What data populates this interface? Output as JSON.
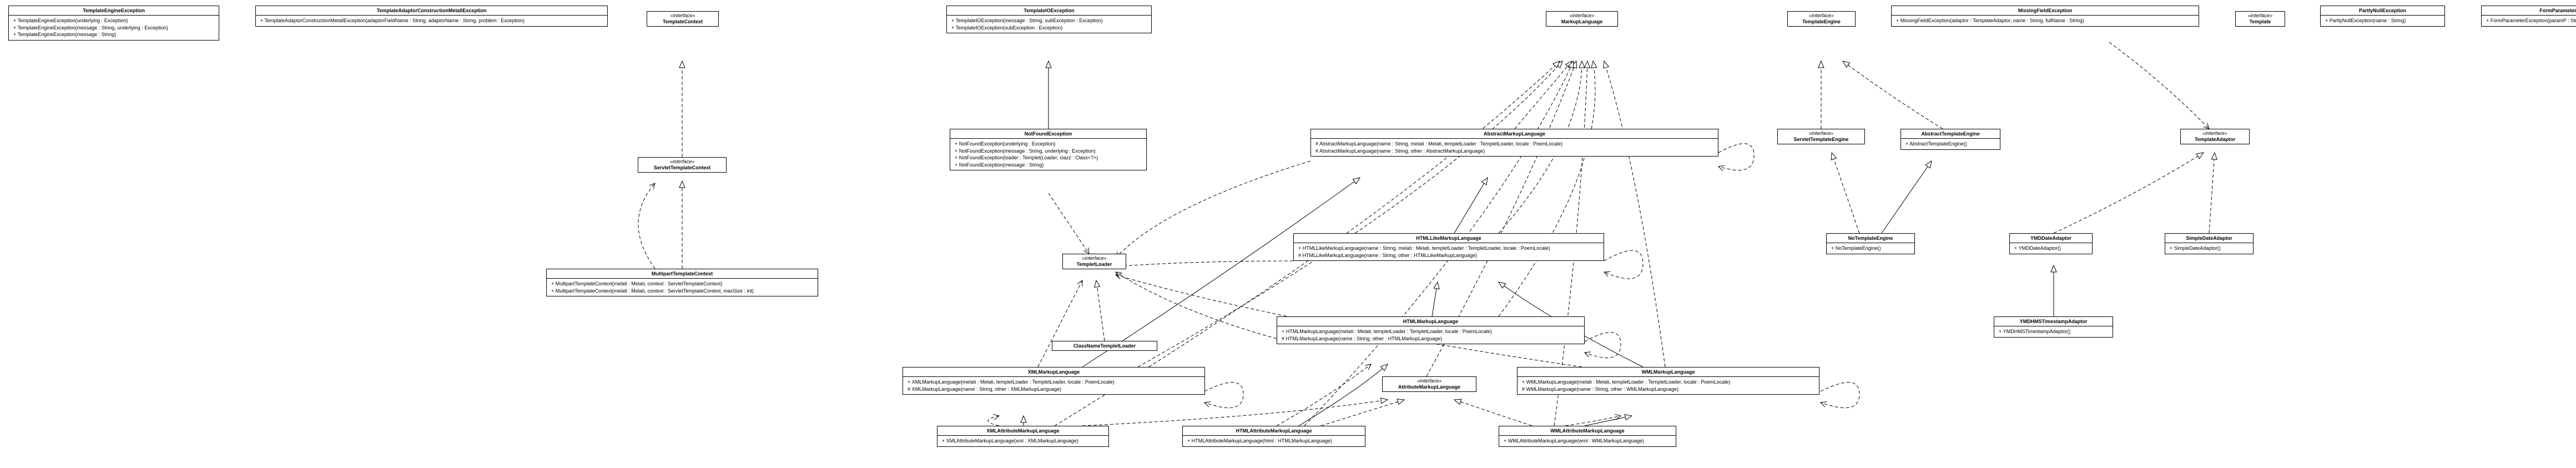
{
  "classes": {
    "TemplateEngineException": {
      "name": "TemplateEngineException",
      "members": [
        "+ TemplateEngineException(underlying : Exception)",
        "+ TemplateEngineException(message : String, underlying : Exception)",
        "+ TemplateEngineException(message : String)"
      ]
    },
    "TemplateAdaptorConstructionMetallException": {
      "name": "TemplateAdaptorConstructionMetallException",
      "members": [
        "+ TemplateAdaptorConstructionMetallException(adaptorFieldName : String, adaptorName : String, problem : Exception)"
      ]
    },
    "TemplateContext": {
      "stereotype": "«interface»",
      "name": "TemplateContext"
    },
    "TemplateIOException": {
      "name": "TemplateIOException",
      "members": [
        "+ TemplateIOException(message : String, subException : Exception)",
        "+ TemplateIOException(subException : Exception)"
      ]
    },
    "MarkupLanguage": {
      "stereotype": "«interface»",
      "name": "MarkupLanguage"
    },
    "TemplateEngine": {
      "stereotype": "«interface»",
      "name": "TemplateEngine"
    },
    "MissingFieldException": {
      "name": "MissingFieldException",
      "members": [
        "+ MissingFieldException(adaptor : TemplateAdaptor, name : String, fullName : String)"
      ]
    },
    "Template": {
      "stereotype": "«interface»",
      "name": "Template"
    },
    "PartlyNullException": {
      "name": "PartlyNullException",
      "members": [
        "+ PartlyNullException(name : String)"
      ]
    },
    "FormParameterException": {
      "name": "FormParameterException",
      "members": [
        "+ FormParameterException(paramP : String, errorP : String)"
      ]
    },
    "ServletTemplateContext": {
      "stereotype": "«interface»",
      "name": "ServletTemplateContext"
    },
    "NotFoundException": {
      "name": "NotFoundException",
      "members": [
        "+ NotFoundException(underlying : Exception)",
        "+ NotFoundException(message : String, underlying : Exception)",
        "+ NotFoundException(loader : Templet(Loader, clazz : Class<?>)",
        "+ NotFoundException(message : String)"
      ]
    },
    "AbstractMarkupLanguage": {
      "name": "AbstractMarkupLanguage",
      "members": [
        "# AbstractMarkupLanguage(name : String, melati : Melati, templetLoader : TempletLoader, locale : PoemLocale)",
        "# AbstractMarkupLanguage(name : String, other : AbstractMarkupLanguage)"
      ]
    },
    "ServletTemplateEngine": {
      "stereotype": "«interface»",
      "name": "ServletTemplateEngine"
    },
    "AbstractTemplateEngine": {
      "name": "AbstractTemplateEngine",
      "members": [
        "+ AbstractTemplateEngine()"
      ]
    },
    "TemplateAdaptor": {
      "stereotype": "«interface»",
      "name": "TemplateAdaptor"
    },
    "MultipartTemplateContext": {
      "name": "MultipartTemplateContext",
      "members": [
        "+ MultipartTemplateContext(melati : Melati, context : ServletTemplateContext)",
        "+ MultipartTemplateContext(melati : Melati, context : ServletTemplateContext, maxSize : int)"
      ]
    },
    "TempletLoader": {
      "stereotype": "«interface»",
      "name": "TempletLoader"
    },
    "HTMLLikeMarkupLanguage": {
      "name": "HTMLLikeMarkupLanguage",
      "members": [
        "+ HTMLLikeMarkupLanguage(name : String, melati : Melati, templetLoader : TempletLoader, locale : PoemLocale)",
        "# HTMLLikeMarkupLanguage(name : String, other : HTMLLikeMarkupLanguage)"
      ]
    },
    "NoTemplateEngine": {
      "name": "NoTemplateEngine",
      "members": [
        "+ NoTemplateEngine()"
      ]
    },
    "YMDDateAdaptor": {
      "name": "YMDDateAdaptor",
      "members": [
        "+ YMDDateAdaptor()"
      ]
    },
    "SimpleDateAdaptor": {
      "name": "SimpleDateAdaptor",
      "members": [
        "+ SimpleDateAdaptor()"
      ]
    },
    "ClassNameTempletLoader": {
      "name": "ClassNameTempletLoader"
    },
    "HTMLMarkupLanguage": {
      "name": "HTMLMarkupLanguage",
      "members": [
        "+ HTMLMarkupLanguage(melati : Melati, templetLoader : TempletLoader, locale : PoemLocale)",
        "# HTMLMarkupLanguage(name : String, other : HTMLMarkupLanguage)"
      ]
    },
    "YMDHMSTimestampAdaptor": {
      "name": "YMDHMSTimestampAdaptor",
      "members": [
        "+ YMDHMSTimestampAdaptor()"
      ]
    },
    "XMLMarkupLanguage": {
      "name": "XMLMarkupLanguage",
      "members": [
        "+ XMLMarkupLanguage(melati : Melati, templetLoader : TempletLoader, locale : PoemLocale)",
        "# XMLMarkupLanguage(name : String, other : XMLMarkupLanguage)"
      ]
    },
    "AttributeMarkupLanguage": {
      "stereotype": "«interface»",
      "name": "AttributeMarkupLanguage"
    },
    "WMLMarkupLanguage": {
      "name": "WMLMarkupLanguage",
      "members": [
        "+ WMLMarkupLanguage(melati : Melati, templetLoader : TempletLoader, locale : PoemLocale)",
        "# WMLMarkupLanguage(name : String, other : WMLMarkupLanguage)"
      ]
    },
    "XMLAttributeMarkupLanguage": {
      "name": "XMLAttributeMarkupLanguage",
      "members": [
        "+ XMLAttributeMarkupLanguage(xml : XMLMarkupLanguage)"
      ]
    },
    "HTMLAttributeMarkupLanguage": {
      "name": "HTMLAttributeMarkupLanguage",
      "members": [
        "+ HTMLAttributeMarkupLanguage(html : HTMLMarkupLanguage)"
      ]
    },
    "WMLAttributeMarkupLanguage": {
      "name": "WMLAttributeMarkupLanguage",
      "members": [
        "+ WMLAttributeMarkupLanguage(wml : WMLMarkupLanguage)"
      ]
    }
  }
}
